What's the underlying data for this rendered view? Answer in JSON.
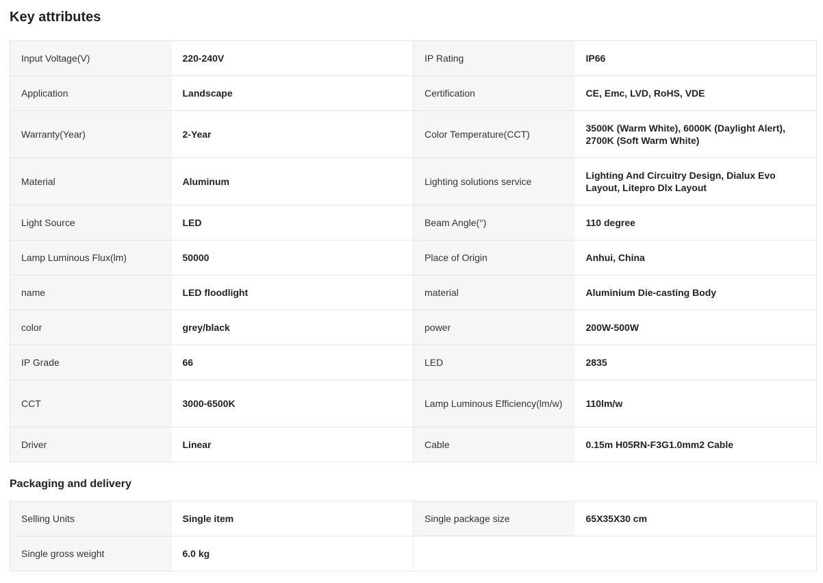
{
  "sections": {
    "key_attributes": {
      "title": "Key attributes",
      "rows": [
        {
          "k1": "Input Voltage(V)",
          "v1": "220-240V",
          "k2": "IP Rating",
          "v2": "IP66"
        },
        {
          "k1": "Application",
          "v1": "Landscape",
          "k2": "Certification",
          "v2": "CE, Emc, LVD, RoHS, VDE"
        },
        {
          "k1": "Warranty(Year)",
          "v1": "2-Year",
          "k2": "Color Temperature(CCT)",
          "v2": "3500K (Warm White), 6000K (Daylight Alert), 2700K (Soft Warm White)"
        },
        {
          "k1": "Material",
          "v1": "Aluminum",
          "k2": "Lighting solutions service",
          "v2": "Lighting And Circuitry Design, Dialux Evo Layout, Litepro Dlx Layout"
        },
        {
          "k1": "Light Source",
          "v1": "LED",
          "k2": "Beam Angle(°)",
          "v2": "110 degree"
        },
        {
          "k1": "Lamp Luminous Flux(lm)",
          "v1": "50000",
          "k2": "Place of Origin",
          "v2": "Anhui, China"
        },
        {
          "k1": "name",
          "v1": "LED floodlight",
          "k2": "material",
          "v2": "Aluminium Die-casting Body"
        },
        {
          "k1": "color",
          "v1": "grey/black",
          "k2": "power",
          "v2": "200W-500W"
        },
        {
          "k1": "IP Grade",
          "v1": "66",
          "k2": "LED",
          "v2": "2835"
        },
        {
          "k1": "CCT",
          "v1": "3000-6500K",
          "k2": "Lamp Luminous Efficiency(lm/w)",
          "v2": "110lm/w"
        },
        {
          "k1": "Driver",
          "v1": "Linear",
          "k2": "Cable",
          "v2": "0.15m H05RN-F3G1.0mm2 Cable"
        }
      ]
    },
    "packaging": {
      "title": "Packaging and delivery",
      "rows": [
        {
          "k1": "Selling Units",
          "v1": "Single item",
          "k2": "Single package size",
          "v2": "65X35X30 cm"
        },
        {
          "k1": "Single gross weight",
          "v1": "6.0 kg"
        }
      ]
    }
  }
}
